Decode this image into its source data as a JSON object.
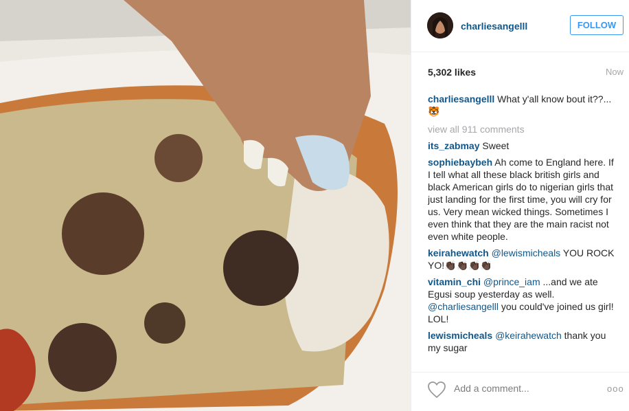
{
  "header": {
    "username": "charliesangelll",
    "follow_label": "FOLLOW"
  },
  "stats": {
    "likes": "5,302 likes",
    "time": "Now"
  },
  "caption": {
    "user": "charliesangelll",
    "text": "What y'all know bout it??... 🐯"
  },
  "view_all": "view all 911 comments",
  "comments": [
    {
      "user": "its_zabmay",
      "text": "Sweet"
    },
    {
      "user": "sophiebaybeh",
      "text": "Ah come to England here. If I tell what all these black british girls and black American girls do to nigerian girls that just landing for the first time, you will cry for us. Very mean wicked things. Sometimes I even think that they are the main racist not even white people."
    },
    {
      "user": "keirahewatch",
      "mention": "@lewismicheals",
      "text": " YOU ROCK YO!👏🏿👏🏿👏🏿👏🏿"
    },
    {
      "user": "vitamin_chi",
      "mention": "@prince_iam",
      "text": " ...and we ate Egusi soup yesterday as well. ",
      "mention2": "@charliesangelll",
      "text2": " you could've joined us girl! LOL!"
    },
    {
      "user": "lewismicheals",
      "mention": "@keirahewatch",
      "text": " thank you my sugar"
    }
  ],
  "footer": {
    "add_comment": "Add a comment...",
    "more_label": "ooo"
  }
}
